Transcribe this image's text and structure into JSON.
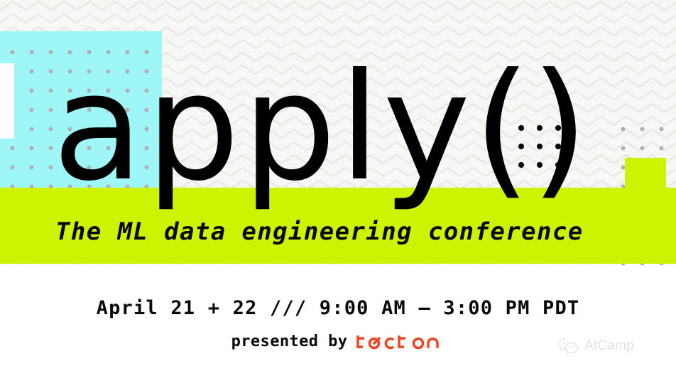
{
  "poster": {
    "brand_wordmark": "apply",
    "paren_open": "(",
    "paren_close": ")",
    "tagline": "The ML data engineering conference",
    "dateline": "April 21 + 22 /// 9:00 AM – 3:00 PM PDT",
    "presented_by_label": "presented by",
    "sponsor_name": "tecton",
    "watermark_text": "AICamp",
    "icons": {
      "paren_dot": "dot-icon",
      "wechat": "wechat-icon"
    },
    "colors": {
      "cyan_block": "#9ef6f6",
      "green_band": "#cdf302",
      "background": "#f7f7f5",
      "chevron_line": "#ececea",
      "dot_gray": "#b0b0b0",
      "text_black": "#000000",
      "tecton_red": "#ee4423",
      "watermark_gray": "#c9c9c9"
    }
  }
}
